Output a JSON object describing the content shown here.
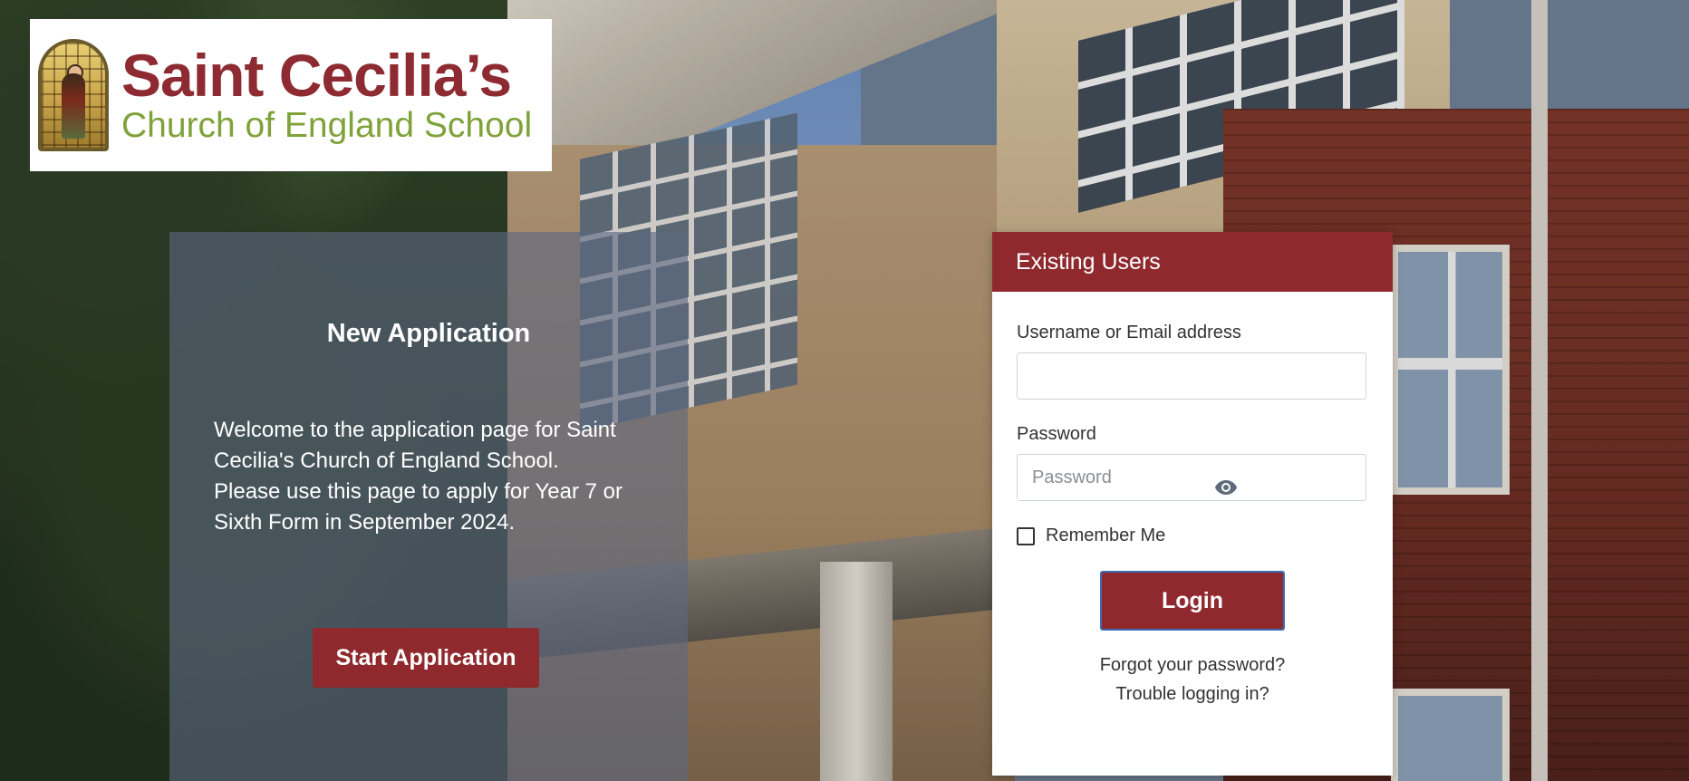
{
  "logo": {
    "title": "Saint Cecilia’s",
    "subtitle": "Church of England School"
  },
  "new_application": {
    "title": "New Application",
    "description": "Welcome to the application page for Saint Cecilia's Church of England School. Please use this page to apply for Year 7 or Sixth Form in September 2024.",
    "button_label": "Start Application"
  },
  "login": {
    "header": "Existing Users",
    "username_label": "Username or Email address",
    "username_value": "",
    "password_label": "Password",
    "password_placeholder": "Password",
    "password_toggle_icon": "eye-icon",
    "remember_label": "Remember Me",
    "remember_checked": false,
    "button_label": "Login",
    "forgot_link": "Forgot your password?",
    "trouble_link": "Trouble logging in?"
  },
  "colors": {
    "brand_red": "#8f292e",
    "logo_green": "#7fa23a",
    "panel_overlay": "rgba(92,103,128,0.62)"
  }
}
